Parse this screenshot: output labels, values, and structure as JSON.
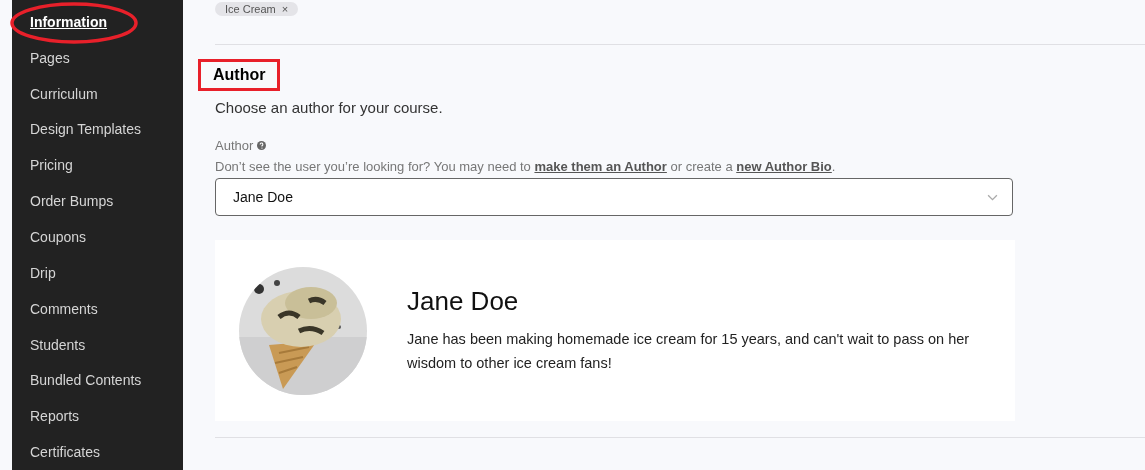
{
  "sidebar": {
    "items": [
      {
        "label": "Information",
        "selected": true,
        "circled": true
      },
      {
        "label": "Pages",
        "selected": false,
        "circled": false
      },
      {
        "label": "Curriculum",
        "selected": false,
        "circled": false
      },
      {
        "label": "Design Templates",
        "selected": false,
        "circled": false
      },
      {
        "label": "Pricing",
        "selected": false,
        "circled": false
      },
      {
        "label": "Order Bumps",
        "selected": false,
        "circled": false
      },
      {
        "label": "Coupons",
        "selected": false,
        "circled": false
      },
      {
        "label": "Drip",
        "selected": false,
        "circled": false
      },
      {
        "label": "Comments",
        "selected": false,
        "circled": false
      },
      {
        "label": "Students",
        "selected": false,
        "circled": false
      },
      {
        "label": "Bundled Contents",
        "selected": false,
        "circled": false
      },
      {
        "label": "Reports",
        "selected": false,
        "circled": false
      },
      {
        "label": "Certificates",
        "selected": false,
        "circled": false
      }
    ]
  },
  "tags": [
    {
      "label": "Ice Cream",
      "remove": "×"
    }
  ],
  "author_section": {
    "heading": "Author",
    "boxed": true,
    "description": "Choose an author for your course.",
    "field": {
      "label": "Author",
      "hint": [
        {
          "text": "Don’t see the user you’re looking for? You may need to ",
          "link": false
        },
        {
          "text": "make them an Author",
          "link": true
        },
        {
          "text": " or create a ",
          "link": false
        },
        {
          "text": "new Author Bio",
          "link": true
        },
        {
          "text": ".",
          "link": false
        }
      ],
      "value": "Jane Doe"
    },
    "card": {
      "name": "Jane Doe",
      "bio": "Jane has been making homemade ice cream for 15 years, and can't wait to pass on her wisdom to other ice cream fans!"
    }
  }
}
